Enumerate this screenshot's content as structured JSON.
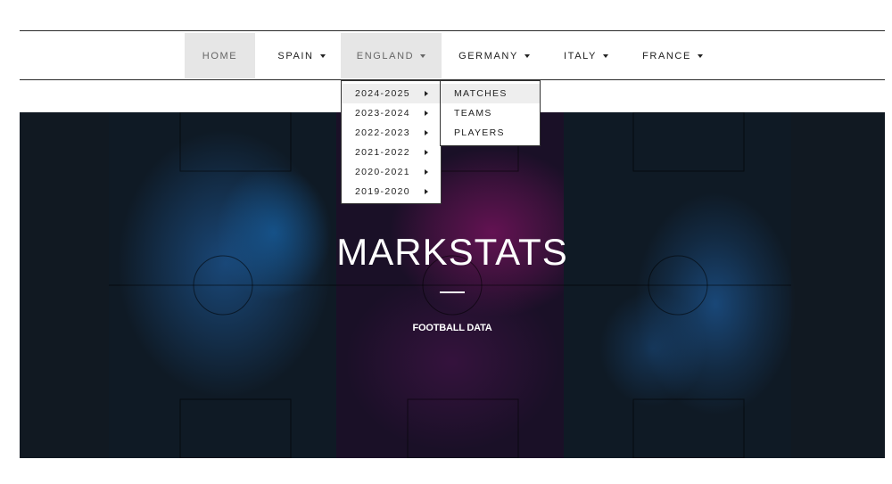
{
  "nav": {
    "items": [
      {
        "label": "HOME",
        "has_caret": false
      },
      {
        "label": "SPAIN",
        "has_caret": true
      },
      {
        "label": "ENGLAND",
        "has_caret": true
      },
      {
        "label": "GERMANY",
        "has_caret": true
      },
      {
        "label": "ITALY",
        "has_caret": true
      },
      {
        "label": "FRANCE",
        "has_caret": true
      }
    ]
  },
  "dropdown": {
    "seasons": [
      "2024-2025",
      "2023-2024",
      "2022-2023",
      "2021-2022",
      "2020-2021",
      "2019-2020"
    ],
    "submenu": [
      "MATCHES",
      "TEAMS",
      "PLAYERS"
    ]
  },
  "hero": {
    "title": "MARKSTATS",
    "subtitle": "FOOTBALL DATA"
  },
  "colors": {
    "hero_bg": "#111922",
    "heat_blue": "#1b4f86",
    "heat_magenta": "#6b1357",
    "menu_highlight": "#e6e6e6"
  }
}
